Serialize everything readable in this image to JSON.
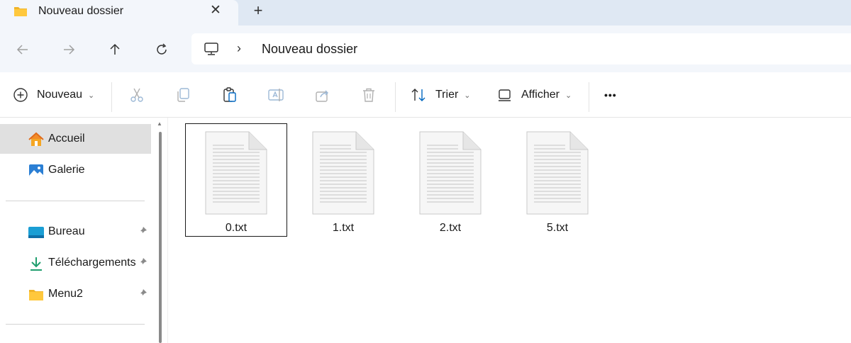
{
  "tab": {
    "title": "Nouveau dossier",
    "close": "✕",
    "new": "+"
  },
  "address": {
    "separator": "›",
    "current": "Nouveau dossier"
  },
  "toolbar": {
    "new_label": "Nouveau",
    "sort_label": "Trier",
    "view_label": "Afficher",
    "more": "•••",
    "chevron": "⌄"
  },
  "sidebar": {
    "items": [
      {
        "label": "Accueil"
      },
      {
        "label": "Galerie"
      },
      {
        "label": "Bureau"
      },
      {
        "label": "Téléchargements"
      },
      {
        "label": "Menu2"
      }
    ]
  },
  "files": [
    {
      "name": "0.txt"
    },
    {
      "name": "1.txt"
    },
    {
      "name": "2.txt"
    },
    {
      "name": "5.txt"
    }
  ],
  "colors": {
    "accent": "#0067c0",
    "folder": "#ffc83d",
    "selection": "#e0e0e0"
  }
}
